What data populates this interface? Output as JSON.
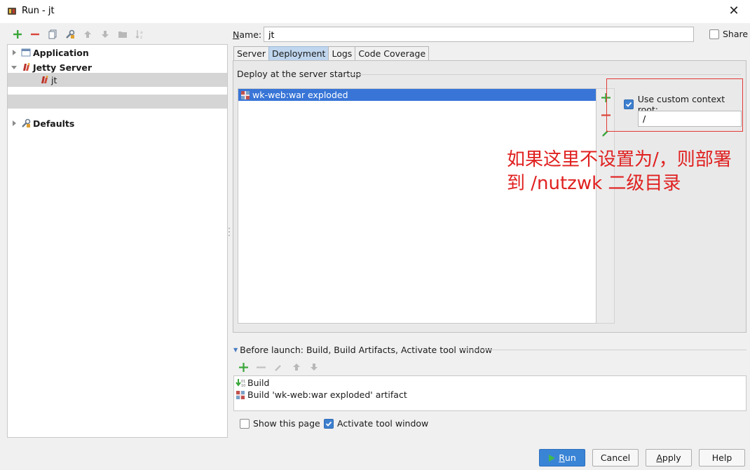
{
  "window": {
    "title": "Run - jt",
    "close_glyph": "✕"
  },
  "left_toolbar": {
    "icons": [
      "add-icon",
      "remove-icon",
      "copy-icon",
      "edit-defaults-icon",
      "move-up-icon",
      "move-down-icon",
      "folder-icon",
      "sort-icon"
    ]
  },
  "tree": {
    "items": [
      {
        "label": "Application",
        "bold": true,
        "expanded": false
      },
      {
        "label": "Jetty Server",
        "bold": true,
        "expanded": true
      },
      {
        "label": "jt",
        "bold": false,
        "selected": true
      },
      {
        "label": "Defaults",
        "bold": true,
        "expanded": false
      }
    ]
  },
  "name": {
    "label_prefix": "N",
    "label_rest": "ame:",
    "value": "jt"
  },
  "share": {
    "label": "Share",
    "checked": false
  },
  "tabs": [
    {
      "label": "Server",
      "active": false
    },
    {
      "label": "Deployment",
      "active": true
    },
    {
      "label": "Logs",
      "active": false
    },
    {
      "label": "Code Coverage",
      "active": false
    }
  ],
  "deployment": {
    "header": "Deploy at the server startup",
    "items": [
      "wk-web:war exploded"
    ],
    "custom_context": {
      "label": "Use custom context root:",
      "checked": true,
      "value": "/"
    }
  },
  "annotation": {
    "line1": "如果这里不设置为/，则部署",
    "line2": "到 /nutzwk 二级目录",
    "color": "#e02020"
  },
  "before_launch": {
    "header": "Before launch: Build, Build Artifacts, Activate tool window",
    "items": [
      "Build",
      "Build 'wk-web:war exploded' artifact"
    ]
  },
  "options": {
    "show_page": {
      "label": "Show this page",
      "checked": false
    },
    "activate_tool_window": {
      "label": "Activate tool window",
      "checked": true
    }
  },
  "buttons": {
    "run": {
      "label_prefix": "R",
      "label_rest": "un"
    },
    "cancel": {
      "label": "Cancel"
    },
    "apply": {
      "label_prefix": "A",
      "label_rest": "pply"
    },
    "help": {
      "label": "Help"
    }
  },
  "colors": {
    "accent": "#3875d7",
    "tab_active": "#bfd6ee",
    "add_green": "#3aa63a",
    "remove_red": "#d9453a"
  }
}
